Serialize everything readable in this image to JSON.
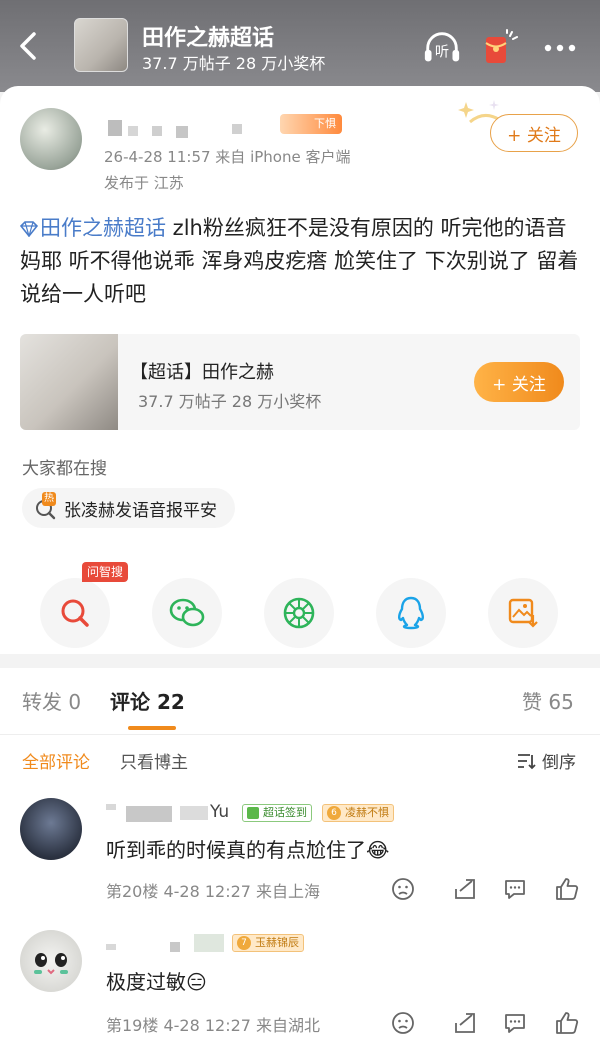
{
  "header": {
    "title": "田作之赫超话",
    "stats": "37.7 万帖子 28 万小奖杯",
    "listen_label": "听"
  },
  "post": {
    "user_badge": "下惧",
    "time_source": "26-4-28 11:57 来自 iPhone 客户端",
    "location": "发布于 江苏",
    "follow_label": "+ 关注",
    "tag": "田作之赫超话",
    "body": " zlh粉丝疯狂不是没有原因的 听完他的语音 妈耶 听不得他说乖 浑身鸡皮疙瘩 尬笑住了 下次别说了 留着说给一人听吧"
  },
  "topic_card": {
    "title": "【超话】田作之赫",
    "stats": "37.7 万帖子 28 万小奖杯",
    "follow_label": "+ 关注"
  },
  "search": {
    "label": "大家都在搜",
    "hot_badge": "热",
    "query": "张凌赫发语音报平安"
  },
  "share": {
    "ai_badge": "问智搜"
  },
  "tabs": {
    "repost": "转发 0",
    "comments": "评论 22",
    "likes": "赞 65"
  },
  "filters": {
    "all": "全部评论",
    "author_only": "只看博主",
    "order": "倒序"
  },
  "comments": [
    {
      "name_suffix": "Yu",
      "checkin_badge": "超话签到",
      "level_badge_num": "6",
      "level_badge_text": "凌赫不惧",
      "text": "听到乖的时候真的有点尬住了",
      "emoji": "😂",
      "meta": "第20楼  4-28 12:27  来自上海"
    },
    {
      "level_badge_num": "7",
      "level_badge_text": "玉赫锦辰",
      "text": "极度过敏",
      "emoji": "😑",
      "meta": "第19楼  4-28 12:27  来自湖北"
    }
  ],
  "colors": {
    "accent": "#f08a1c",
    "link": "#4a7cc9",
    "badge_red": "#e84a3a"
  }
}
